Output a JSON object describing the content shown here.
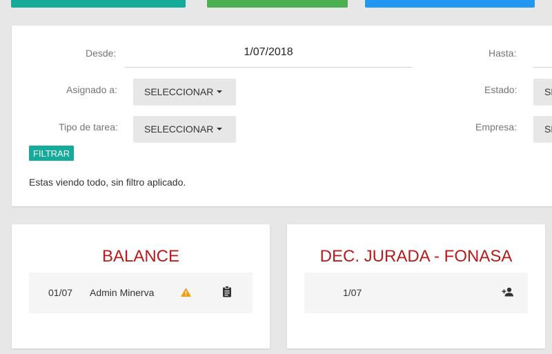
{
  "filters": {
    "desde_label": "Desde:",
    "desde_value": "1/07/2018",
    "hasta_label": "Hasta:",
    "asignado_label": "Asignado a:",
    "asignado_value": "SELECCIONAR",
    "estado_label": "Estado:",
    "estado_value": "SELECCIONAR",
    "tipo_label": "Tipo de tarea:",
    "tipo_value": "SELECCIONAR",
    "empresa_label": "Empresa:",
    "empresa_value": "SELECCIONAR",
    "filter_button": "FILTRAR",
    "status_text": "Estas viendo todo, sin filtro aplicado."
  },
  "tasks": [
    {
      "title": "BALANCE",
      "rows": [
        {
          "date": "01/07",
          "assignee": "Admin Minerva",
          "icons": [
            "warning-icon",
            "clipboard-icon"
          ]
        }
      ]
    },
    {
      "title": "DEC. JURADA - FONASA",
      "rows": [
        {
          "date": "1/07",
          "icons": [
            "person-add-icon"
          ]
        }
      ]
    }
  ],
  "colors": {
    "accent_teal": "#14ab9b",
    "green": "#4caf50",
    "blue": "#2196f3",
    "task_title": "#b71c1c",
    "warning": "#f39c12"
  }
}
